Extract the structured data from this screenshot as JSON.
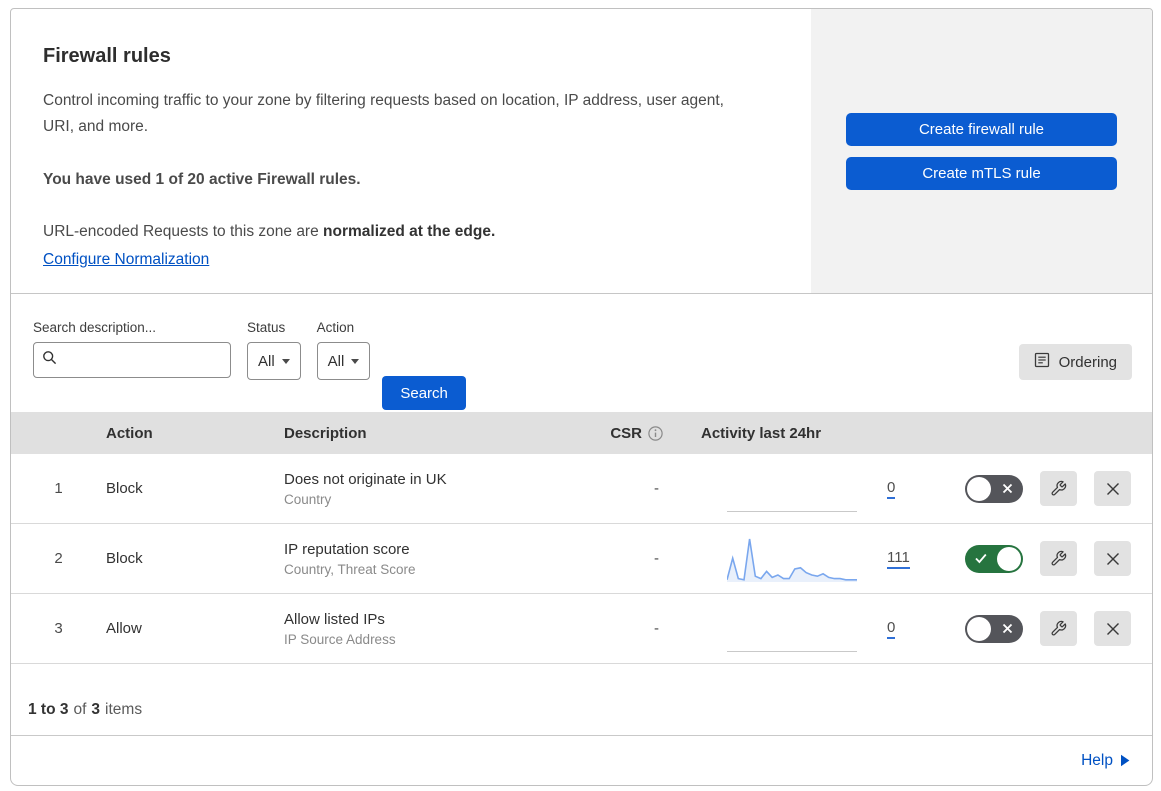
{
  "header": {
    "title": "Firewall rules",
    "description": "Control incoming traffic to your zone by filtering requests based on location, IP address, user agent, URI, and more.",
    "usage_bold": "You have used 1 of 20 active Firewall rules.",
    "normalization_text": "URL-encoded Requests to this zone are ",
    "normalization_bold": "normalized at the edge.",
    "normalization_link": "Configure Normalization",
    "buttons": {
      "create_firewall": "Create firewall rule",
      "create_mtls": "Create mTLS rule"
    }
  },
  "filters": {
    "search_label": "Search description...",
    "search_value": "",
    "status_label": "Status",
    "status_value": "All",
    "action_label": "Action",
    "action_value": "All",
    "search_button": "Search",
    "ordering_button": "Ordering"
  },
  "table": {
    "headers": {
      "action": "Action",
      "description": "Description",
      "csr": "CSR",
      "activity": "Activity last 24hr"
    },
    "rows": [
      {
        "num": "1",
        "action": "Block",
        "description": "Does not originate in UK",
        "criteria": "Country",
        "csr": "-",
        "count": "0",
        "enabled": false,
        "sparkline": []
      },
      {
        "num": "2",
        "action": "Block",
        "description": "IP reputation score",
        "criteria": "Country, Threat Score",
        "csr": "-",
        "count": "111",
        "enabled": true,
        "sparkline": [
          1,
          19,
          2,
          1,
          35,
          4,
          2,
          8,
          3,
          5,
          2,
          2,
          10,
          11,
          7,
          5,
          4,
          6,
          3,
          2,
          2,
          1,
          1,
          1
        ]
      },
      {
        "num": "3",
        "action": "Allow",
        "description": "Allow listed IPs",
        "criteria": "IP Source Address",
        "csr": "-",
        "count": "0",
        "enabled": false,
        "sparkline": []
      }
    ]
  },
  "footer": {
    "range": "1 to 3",
    "of": "of",
    "total": "3",
    "items": "items"
  },
  "help": {
    "label": "Help"
  },
  "colors": {
    "accent_blue": "#0b5cd1",
    "link_blue": "#0051c3",
    "toggle_on_green": "#26743f",
    "toggle_off_gray": "#54555a",
    "sparkline_blue": "#7aa7ee",
    "table_header_gray": "#e0e0e0",
    "panel_gray": "#f2f2f2"
  }
}
